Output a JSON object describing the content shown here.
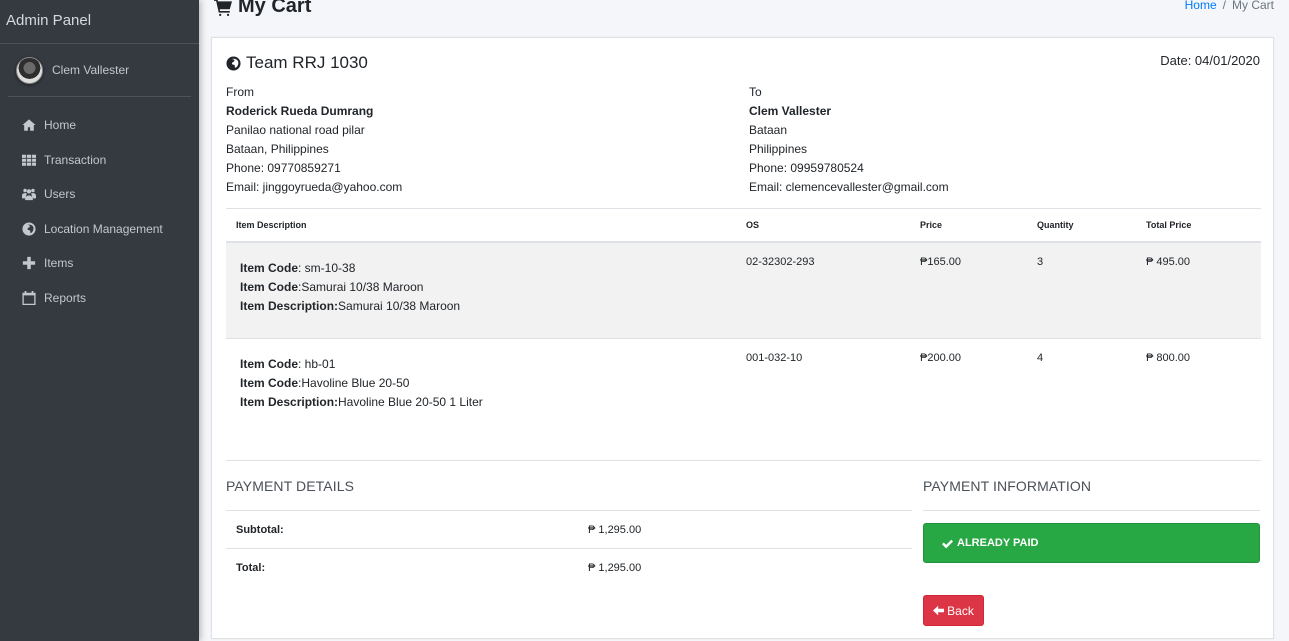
{
  "sidebar": {
    "brand": "Admin Panel",
    "user": {
      "name": "Clem Vallester",
      "avatar_icon": "user-avatar"
    },
    "items": [
      {
        "label": "Home",
        "icon": "home-icon"
      },
      {
        "label": "Transaction",
        "icon": "grid-icon"
      },
      {
        "label": "Users",
        "icon": "users-icon"
      },
      {
        "label": "Location Management",
        "icon": "globe-icon"
      },
      {
        "label": "Items",
        "icon": "plus-icon"
      },
      {
        "label": "Reports",
        "icon": "calendar-icon"
      }
    ]
  },
  "header": {
    "title": "My Cart",
    "title_icon": "cart-icon",
    "breadcrumb": [
      {
        "label": "Home",
        "link": true
      },
      {
        "label": "My Cart",
        "link": false
      }
    ]
  },
  "invoice": {
    "team": "Team RRJ 1030",
    "date": "Date: 04/01/2020",
    "from": {
      "label": "From",
      "name": "Roderick Rueda Dumrang",
      "line1": "Panilao national road pilar",
      "line2": "Bataan, Philippines",
      "phone": "Phone: 09770859271",
      "email": "Email: jinggoyrueda@yahoo.com"
    },
    "to": {
      "label": "To",
      "name": "Clem Vallester",
      "line1": "Bataan",
      "line2": "Philippines",
      "phone": "Phone: 09959780524",
      "email": "Email: clemencevallester@gmail.com"
    },
    "columns": [
      "Item Description",
      "OS",
      "Price",
      "Quantity",
      "Total Price"
    ],
    "items": [
      {
        "code_label": "Item Code",
        "code": ": sm-10-38",
        "name_label": "Item Code",
        "name": ":Samurai 10/38 Maroon",
        "desc_label": "Item Description:",
        "desc": "Samurai 10/38 Maroon",
        "os": "02-32302-293",
        "price": "₱165.00",
        "quantity": "3",
        "total": "₱ 495.00"
      },
      {
        "code_label": "Item Code",
        "code": ": hb-01",
        "name_label": "Item Code",
        "name": ":Havoline Blue 20-50",
        "desc_label": "Item Description:",
        "desc": "Havoline Blue 20-50 1 Liter",
        "os": "001-032-10",
        "price": "₱200.00",
        "quantity": "4",
        "total": "₱ 800.00"
      }
    ]
  },
  "payment_details": {
    "title": "PAYMENT DETAILS",
    "rows": [
      {
        "label": "Subtotal:",
        "value": "₱ 1,295.00"
      },
      {
        "label": "Total:",
        "value": "₱ 1,295.00"
      }
    ]
  },
  "payment_information": {
    "title": "PAYMENT INFORMATION",
    "status_label": "ALREADY PAID",
    "status_color": "#28a745",
    "back_label": "Back",
    "back_color": "#dc3545"
  }
}
